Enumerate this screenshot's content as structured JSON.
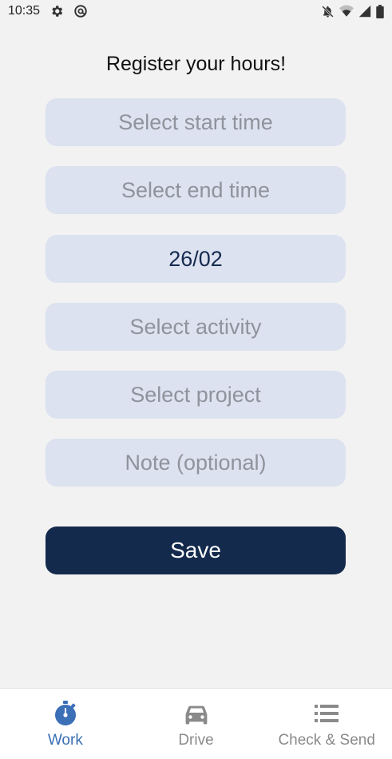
{
  "status_bar": {
    "time": "10:35",
    "icons_left": [
      "settings-gear-icon",
      "vpn-at-icon"
    ],
    "icons_right": [
      "notifications-off-icon",
      "wifi-icon",
      "signal-icon",
      "battery-icon"
    ]
  },
  "page": {
    "title": "Register your hours!"
  },
  "form": {
    "start_time": {
      "value": "",
      "placeholder": "Select start time"
    },
    "end_time": {
      "value": "",
      "placeholder": "Select end time"
    },
    "date": {
      "value": "26/02",
      "placeholder": ""
    },
    "activity": {
      "value": "",
      "placeholder": "Select activity"
    },
    "project": {
      "value": "",
      "placeholder": "Select project"
    },
    "note": {
      "value": "",
      "placeholder": "Note (optional)"
    },
    "save_label": "Save"
  },
  "bottom_nav": {
    "items": [
      {
        "label": "Work",
        "icon": "stopwatch-icon",
        "active": true
      },
      {
        "label": "Drive",
        "icon": "car-icon",
        "active": false
      },
      {
        "label": "Check & Send",
        "icon": "list-icon",
        "active": false
      }
    ]
  },
  "colors": {
    "background": "#f2f2f2",
    "field_bg": "#dce2ef",
    "placeholder_text": "#8e939c",
    "filled_text": "#152a4f",
    "primary": "#132a4c",
    "nav_active": "#3b6fb6",
    "nav_inactive": "#8a8a8a"
  }
}
